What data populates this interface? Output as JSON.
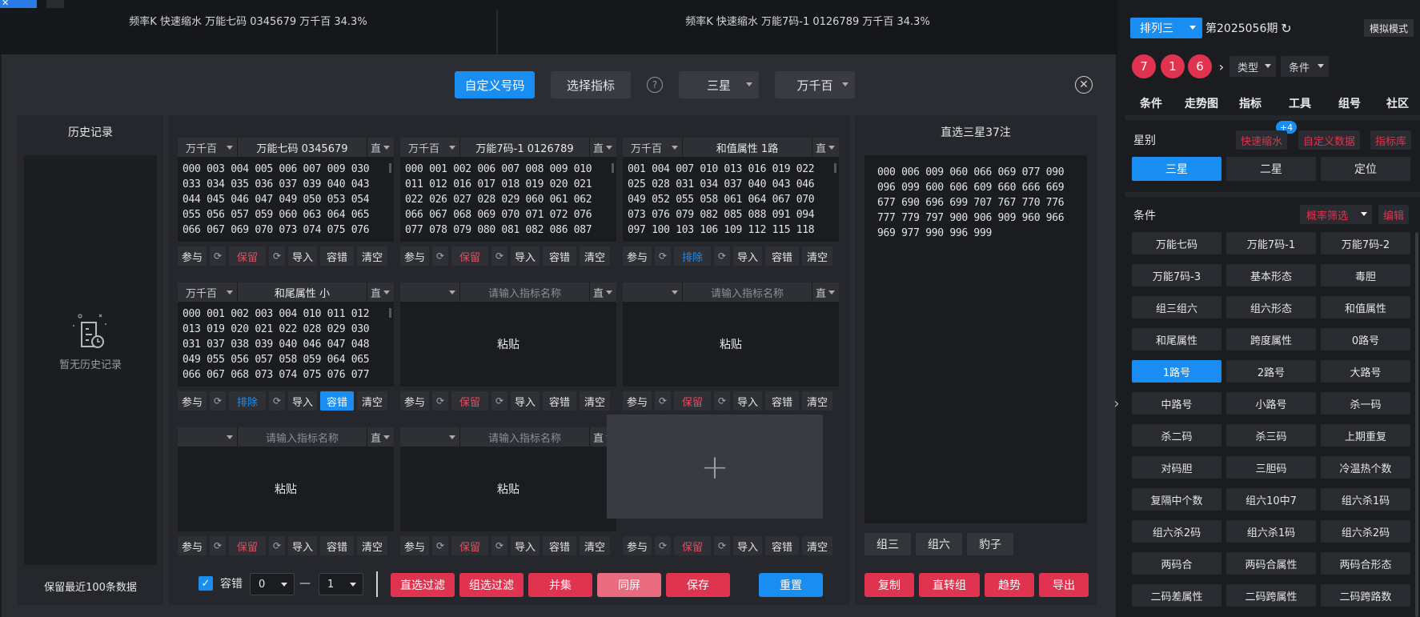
{
  "top_strip": {
    "tab_label": "✕",
    "chart1_title": "频率K  快速缩水  万能七码 0345679  万千百  34.3%",
    "chart2_title": "频率K  快速缩水  万能7码-1 0126789  万千百  34.3%"
  },
  "modal": {
    "btn_custom": "自定义号码",
    "btn_select_indicator": "选择指标",
    "help": "?",
    "sel_star": "三星",
    "sel_pos": "万千百",
    "close": "✕"
  },
  "history": {
    "title": "历史记录",
    "empty": "暂无历史记录",
    "footer": "保留最近100条数据"
  },
  "cards": [
    {
      "pos": "万千百",
      "name": "万能七码 0345679",
      "dir": "直",
      "body": "000 003 004 005 006 007 009 030 033 034 035 036 037 039 040 043 044 045 046 047 049 050 053 054 055 056 057 059 060 063 064 065 066 067 069 070 073 074 075 076",
      "mode": "保留",
      "mode_type": "red",
      "rong_on": false
    },
    {
      "pos": "万千百",
      "name": "万能7码-1 0126789",
      "dir": "直",
      "body": "000 001 002 006 007 008 009 010 011 012 016 017 018 019 020 021 022 026 027 028 029 060 061 062 066 067 068 069 070 071 072 076 077 078 079 080 081 082 086 087",
      "mode": "保留",
      "mode_type": "red",
      "rong_on": false
    },
    {
      "pos": "万千百",
      "name": "和值属性 1路",
      "dir": "直",
      "body": "001 004 007 010 013 016 019 022 025 028 031 034 037 040 043 046 049 052 055 058 061 064 067 070 073 076 079 082 085 088 091 094 097 100 103 106 109 112 115 118",
      "mode": "排除",
      "mode_type": "blue",
      "rong_on": false
    },
    {
      "pos": "万千百",
      "name": "和尾属性 小",
      "dir": "直",
      "body": "000 001 002 003 004 010 011 012 013 019 020 021 022 028 029 030 031 037 038 039 040 046 047 048 049 055 056 057 058 059 064 065 066 067 068 073 074 075 076 077",
      "mode": "排除",
      "mode_type": "blue",
      "rong_on": true
    },
    {
      "pos": "",
      "name": "请输入指标名称",
      "dir": "直",
      "paste": "粘贴",
      "mode": "保留",
      "mode_type": "red",
      "rong_on": false
    },
    {
      "pos": "",
      "name": "请输入指标名称",
      "dir": "直",
      "paste": "粘贴",
      "mode": "保留",
      "mode_type": "red",
      "rong_on": false
    },
    {
      "pos": "",
      "name": "请输入指标名称",
      "dir": "直",
      "paste": "粘贴",
      "mode": "保留",
      "mode_type": "red",
      "rong_on": false
    },
    {
      "pos": "",
      "name": "请输入指标名称",
      "dir": "直",
      "paste": "粘贴",
      "mode": "保留",
      "mode_type": "red",
      "rong_on": false
    }
  ],
  "add_card": "+",
  "toolbar": {
    "join": "参与",
    "refresh": "⟳",
    "import": "导入",
    "rong": "容错",
    "clear": "清空"
  },
  "bottom": {
    "check": "✓",
    "rong_label": "容错",
    "min": "0",
    "dash": "—",
    "max": "1",
    "btn_direct_filter": "直选过滤",
    "btn_group_filter": "组选过滤",
    "btn_union": "并集",
    "btn_same_screen": "同屏",
    "btn_save": "保存",
    "btn_reset": "重置"
  },
  "result": {
    "title": "直选三星37注",
    "numbers": "000 006 009 060 066 069 077 090 096 099 600 606 609 660 666 669 677 690 696 699 707 767 770 776 777 779 797 900 906 909 960 966 969 977 990 996 999",
    "group3": "组三",
    "group6": "组六",
    "leopard": "豹子",
    "copy": "复制",
    "to_group": "直转组",
    "trend": "趋势",
    "export": "导出"
  },
  "sidebar": {
    "lottery": "排列三",
    "period": "第2025056期",
    "refresh": "↻",
    "mode": "模拟模式",
    "balls": [
      "7",
      "1",
      "6"
    ],
    "more": "›",
    "dd_type": "类型",
    "dd_cond": "条件",
    "nav": [
      "条件",
      "走势图",
      "指标",
      "工具",
      "组号",
      "社区"
    ],
    "badge": "+4",
    "star_label": "星别",
    "quick": "快速缩水",
    "custom_data": "自定义数据",
    "indicator_lib": "指标库",
    "star_tabs": [
      "三星",
      "二星",
      "定位"
    ],
    "cond_label": "条件",
    "prob_filter": "概率筛选",
    "edit": "编辑",
    "grid": [
      "万能七码",
      "万能7码-1",
      "万能7码-2",
      "万能7码-3",
      "基本形态",
      "毒胆",
      "组三组六",
      "组六形态",
      "和值属性",
      "和尾属性",
      "跨度属性",
      "0路号",
      "1路号",
      "2路号",
      "大路号",
      "中路号",
      "小路号",
      "杀一码",
      "杀二码",
      "杀三码",
      "上期重复",
      "对码胆",
      "三胆码",
      "冷温热个数",
      "复隔中个数",
      "组六10中7",
      "组六杀1码",
      "组六杀2码",
      "组六杀1码",
      "组六杀2码",
      "两码合",
      "两码合属性",
      "两码合形态",
      "二码差属性",
      "二码跨属性",
      "二码跨路数"
    ],
    "collapse": "›"
  },
  "colors": {
    "accent": "#1a8df3",
    "red": "#e0334f",
    "panel": "#26272c",
    "bg": "#1b1c20"
  }
}
